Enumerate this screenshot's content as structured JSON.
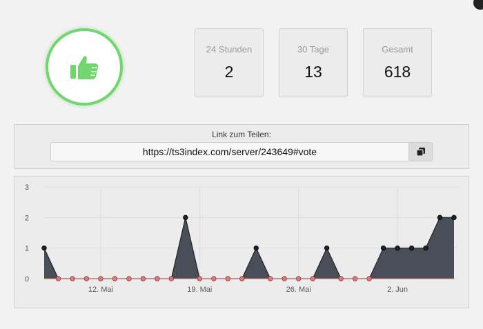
{
  "vote_icon": "thumbs-up-icon",
  "accent_color": "#72d66f",
  "stats": [
    {
      "label": "24 Stunden",
      "value": "2"
    },
    {
      "label": "30 Tage",
      "value": "13"
    },
    {
      "label": "Gesamt",
      "value": "618"
    }
  ],
  "share": {
    "label": "Link zum Teilen:",
    "url": "https://ts3index.com/server/243649#vote",
    "copy_icon": "copy-icon"
  },
  "chart_data": {
    "type": "area",
    "x_tick_labels": [
      "12. Mai",
      "19. Mai",
      "26. Mai",
      "2. Jun"
    ],
    "y_tick_labels": [
      "0",
      "1",
      "2",
      "3"
    ],
    "ylim": [
      0,
      3
    ],
    "grid": true,
    "values": [
      1,
      0,
      0,
      0,
      0,
      0,
      0,
      0,
      0,
      0,
      2,
      0,
      0,
      0,
      0,
      1,
      0,
      0,
      0,
      0,
      1,
      0,
      0,
      0,
      1,
      1,
      1,
      1,
      2,
      2
    ],
    "fill_color": "#4a4e58",
    "zero_point_color": "#e07a7a",
    "point_color": "#1e222a"
  }
}
